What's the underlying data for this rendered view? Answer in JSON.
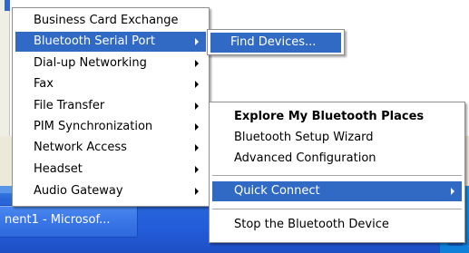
{
  "menu_main": {
    "items": [
      {
        "label": "Business Card Exchange",
        "submenu": false
      },
      {
        "label": "Bluetooth Serial Port",
        "submenu": true
      },
      {
        "label": "Dial-up Networking",
        "submenu": true
      },
      {
        "label": "Fax",
        "submenu": true
      },
      {
        "label": "File Transfer",
        "submenu": true
      },
      {
        "label": "PIM Synchronization",
        "submenu": true
      },
      {
        "label": "Network Access",
        "submenu": true
      },
      {
        "label": "Headset",
        "submenu": true
      },
      {
        "label": "Audio Gateway",
        "submenu": true
      }
    ]
  },
  "menu_sub": {
    "find_devices": "Find Devices..."
  },
  "menu_tray": {
    "explore": "Explore My Bluetooth Places",
    "setup_wizard": "Bluetooth Setup Wizard",
    "advanced": "Advanced Configuration",
    "quick_connect": "Quick Connect",
    "stop": "Stop the Bluetooth Device"
  },
  "taskbar": {
    "window_button": "nent1 - Microsof..."
  },
  "colors": {
    "highlight": "#316ac5",
    "taskbar": "#245edb"
  }
}
